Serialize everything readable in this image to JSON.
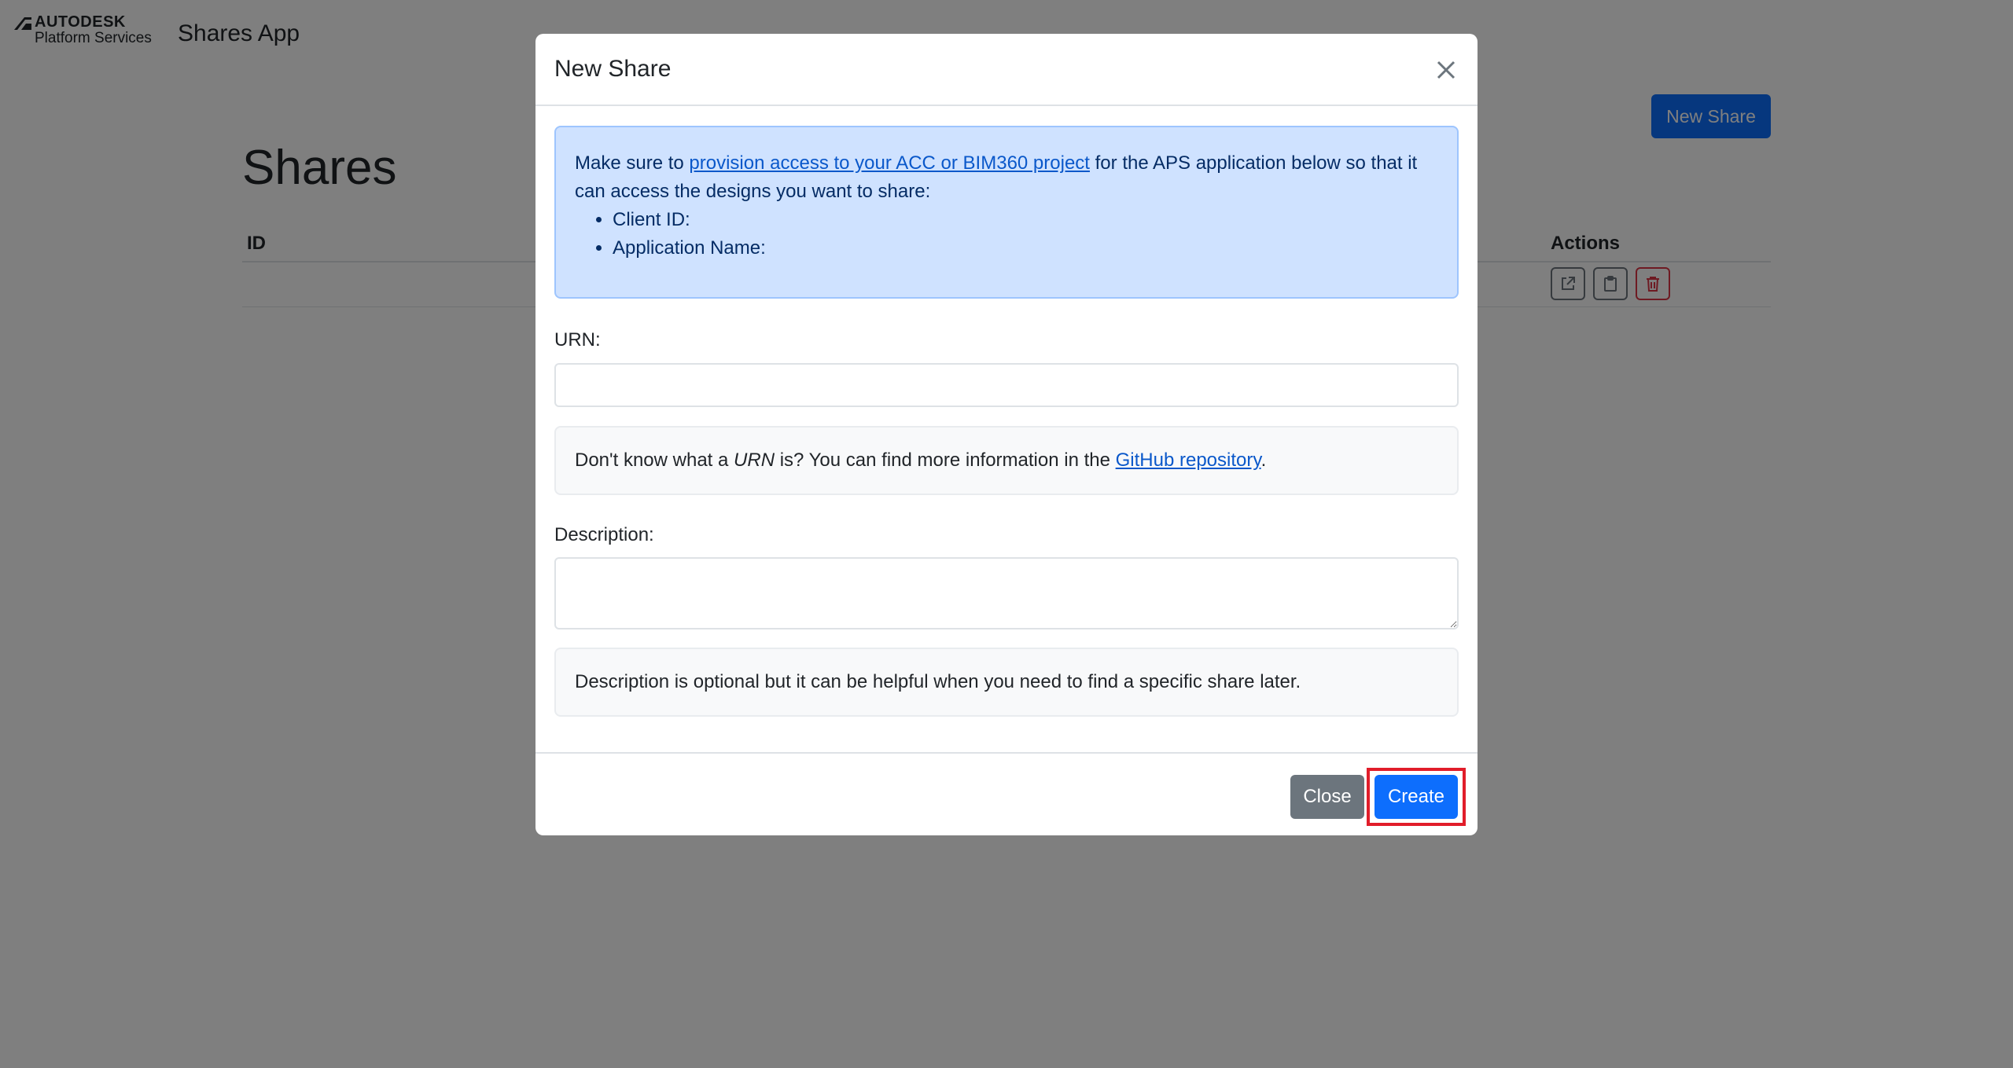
{
  "navbar": {
    "brand_top": "AUTODESK",
    "brand_bottom": "Platform Services",
    "app_title": "Shares App"
  },
  "page": {
    "new_share_label": "New Share",
    "title": "Shares",
    "table": {
      "headers": {
        "id": "ID",
        "actions": "Actions"
      },
      "row_action_icons": [
        "external-link-icon",
        "clipboard-icon",
        "trash-icon"
      ]
    }
  },
  "modal": {
    "title": "New Share",
    "info": {
      "prefix": "Make sure to ",
      "link_text": "provision access to your ACC or BIM360 project",
      "suffix": " for the APS application below so that it can access the designs you want to share:",
      "items": [
        "Client ID:",
        "Application Name:"
      ]
    },
    "urn": {
      "label": "URN:",
      "value": "",
      "help_prefix": "Don't know what a ",
      "help_em": "URN",
      "help_middle": " is? You can find more information in the ",
      "help_link": "GitHub repository",
      "help_suffix": "."
    },
    "description": {
      "label": "Description:",
      "value": "",
      "help": "Description is optional but it can be helpful when you need to find a specific share later."
    },
    "footer": {
      "close_label": "Close",
      "create_label": "Create"
    }
  },
  "colors": {
    "primary": "#0d6efd",
    "secondary": "#6c757d",
    "danger": "#dc3545",
    "info_bg": "#cfe2ff",
    "highlight": "#e11d2a"
  }
}
